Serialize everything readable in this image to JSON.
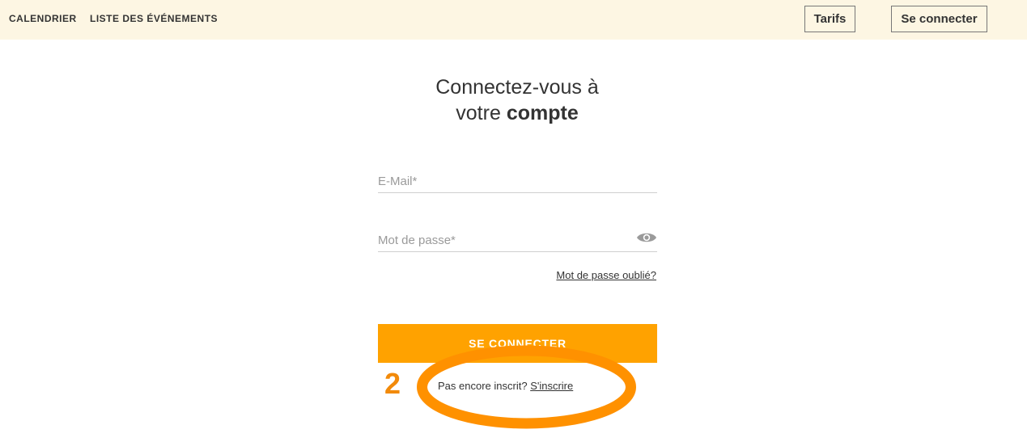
{
  "nav": {
    "calendar": "CALENDRIER",
    "events": "LISTE DES ÉVÉNEMENTS",
    "tarifs": "Tarifs",
    "connect": "Se connecter"
  },
  "login": {
    "title_line1": "Connectez-vous à",
    "title_line2_prefix": "votre ",
    "title_line2_bold": "compte",
    "email_placeholder": "E-Mail*",
    "password_placeholder": "Mot de passe*",
    "forgot": "Mot de passe oublié?",
    "submit": "SE CONNECTER",
    "no_account": "Pas encore inscrit?",
    "signup": "S'inscrire"
  },
  "annotation": {
    "step_number": "2"
  },
  "icons": {
    "password_toggle": "eye-icon"
  },
  "colors": {
    "accent": "#ffa200",
    "annotation": "#f28a0a",
    "topbar_bg": "#fdf6e3"
  }
}
